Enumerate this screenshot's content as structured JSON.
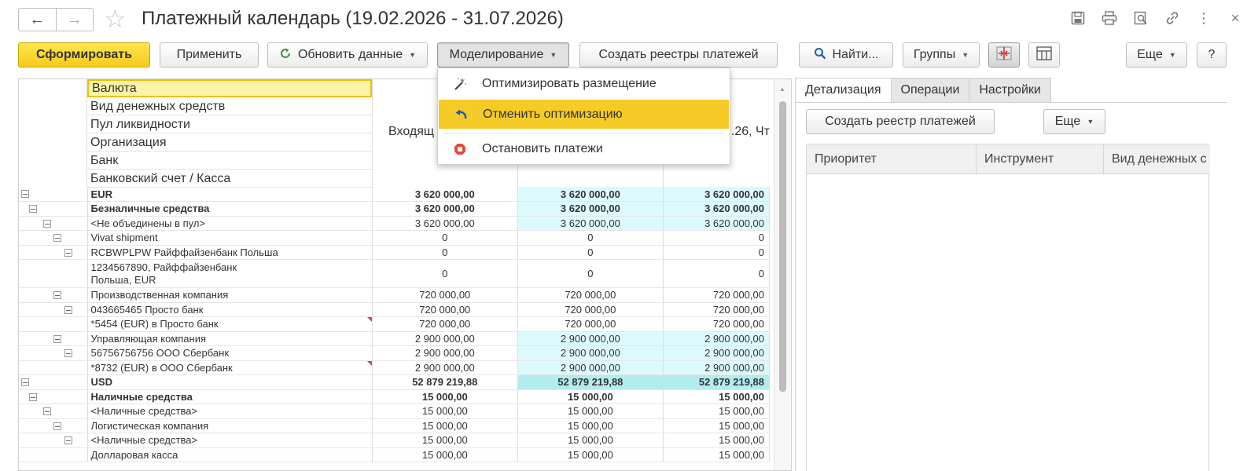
{
  "window": {
    "title": "Платежный календарь (19.02.2026 - 31.07.2026)",
    "back_icon": "←",
    "forward_icon": "→",
    "star_icon": "☆",
    "icons": [
      "save-icon",
      "print-icon",
      "preview-icon",
      "link-icon",
      "more-vertical-icon",
      "close-icon"
    ],
    "close_glyph": "×",
    "more_glyph": "⋮"
  },
  "toolbar": {
    "generate": "Сформировать",
    "apply": "Применить",
    "refresh": "Обновить данные",
    "modeling": "Моделирование",
    "create_registers": "Создать реестры платежей",
    "find": "Найти...",
    "groups": "Группы",
    "more": "Еще",
    "help": "?"
  },
  "modeling_menu": {
    "items": [
      {
        "label": "Оптимизировать размещение",
        "icon": "magic-wand-icon"
      },
      {
        "label": "Отменить оптимизацию",
        "icon": "undo-icon",
        "active": true
      },
      {
        "label": "Остановить платежи",
        "icon": "stop-icon"
      }
    ]
  },
  "report": {
    "header_fields": [
      "Валюта",
      "Вид денежных средств",
      "Пул ликвидности",
      "Организация",
      "Банк",
      "Банковский счет / Касса"
    ],
    "column_headers": [
      "Входящ",
      ".26, Чт"
    ],
    "rows": [
      {
        "level": 0,
        "name": "EUR",
        "bold": true,
        "v": [
          "3 620 000,00",
          "3 620 000,00",
          "3 620 000,00"
        ],
        "hl": 1
      },
      {
        "level": 1,
        "name": "Безналичные средства",
        "bold": true,
        "v": [
          "3 620 000,00",
          "3 620 000,00",
          "3 620 000,00"
        ],
        "hl": 1
      },
      {
        "level": 2,
        "name": "<Не объединены в пул>",
        "v": [
          "3 620 000,00",
          "3 620 000,00",
          "3 620 000,00"
        ],
        "hl": 1
      },
      {
        "level": 3,
        "name": "Vivat shipment",
        "v": [
          "0",
          "0",
          "0"
        ]
      },
      {
        "level": 4,
        "name": "RCBWPLPW Райффайзенбанк Польша",
        "v": [
          "0",
          "0",
          "0"
        ]
      },
      {
        "level": 5,
        "name": "1234567890, Райффайзенбанк",
        "name2": "Польша, EUR",
        "v": [
          "0",
          "0",
          "0"
        ],
        "tall": true
      },
      {
        "level": 3,
        "name": "Производственная компания",
        "v": [
          "720 000,00",
          "720 000,00",
          "720 000,00"
        ]
      },
      {
        "level": 4,
        "name": "043665465 Просто банк",
        "v": [
          "720 000,00",
          "720 000,00",
          "720 000,00"
        ]
      },
      {
        "level": 5,
        "name": "*5454 (EUR) в Просто банк",
        "v": [
          "720 000,00",
          "720 000,00",
          "720 000,00"
        ],
        "mark": true
      },
      {
        "level": 3,
        "name": "Управляющая компания",
        "v": [
          "2 900 000,00",
          "2 900 000,00",
          "2 900 000,00"
        ],
        "hl": 1
      },
      {
        "level": 4,
        "name": "56756756756 ООО Сбербанк",
        "v": [
          "2 900 000,00",
          "2 900 000,00",
          "2 900 000,00"
        ],
        "hl": 1
      },
      {
        "level": 5,
        "name": "*8732 (EUR) в ООО Сбербанк",
        "v": [
          "2 900 000,00",
          "2 900 000,00",
          "2 900 000,00"
        ],
        "hl": 1,
        "mark": true
      },
      {
        "level": 0,
        "name": "USD",
        "bold": true,
        "v": [
          "52 879 219,88",
          "52 879 219,88",
          "52 879 219,88"
        ],
        "hl": 2
      },
      {
        "level": 1,
        "name": "Наличные средства",
        "bold": true,
        "v": [
          "15 000,00",
          "15 000,00",
          "15 000,00"
        ]
      },
      {
        "level": 2,
        "name": "<Наличные средства>",
        "v": [
          "15 000,00",
          "15 000,00",
          "15 000,00"
        ]
      },
      {
        "level": 3,
        "name": "Логистическая компания",
        "v": [
          "15 000,00",
          "15 000,00",
          "15 000,00"
        ]
      },
      {
        "level": 4,
        "name": "<Наличные средства>",
        "v": [
          "15 000,00",
          "15 000,00",
          "15 000,00"
        ]
      },
      {
        "level": 5,
        "name": "Долларовая касса",
        "v": [
          "15 000,00",
          "15 000,00",
          "15 000,00"
        ]
      }
    ]
  },
  "right_panel": {
    "tabs": [
      "Детализация",
      "Операции",
      "Настройки"
    ],
    "create_register": "Создать реестр платежей",
    "more": "Еще",
    "columns": [
      "Приоритет",
      "Инструмент",
      "Вид денежных с"
    ]
  }
}
